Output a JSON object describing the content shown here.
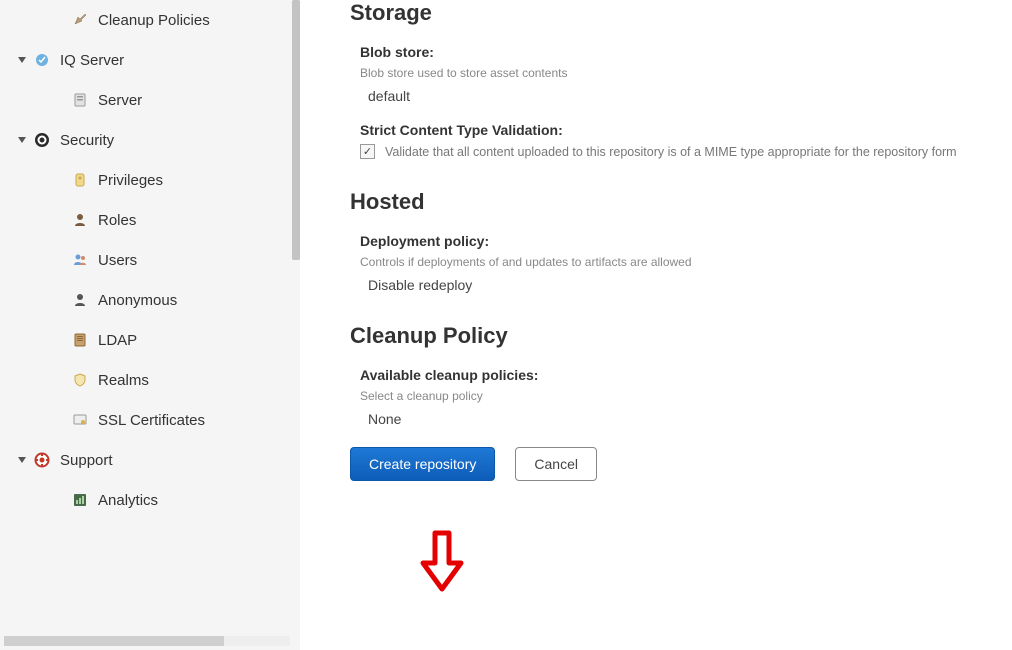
{
  "sidebar": {
    "cleanup_policies": "Cleanup Policies",
    "iq_server": "IQ Server",
    "server": "Server",
    "security": "Security",
    "privileges": "Privileges",
    "roles": "Roles",
    "users": "Users",
    "anonymous": "Anonymous",
    "ldap": "LDAP",
    "realms": "Realms",
    "ssl_certs": "SSL Certificates",
    "support": "Support",
    "analytics": "Analytics"
  },
  "storage": {
    "title": "Storage",
    "blob_label": "Blob store:",
    "blob_help": "Blob store used to store asset contents",
    "blob_value": "default",
    "strict_label": "Strict Content Type Validation:",
    "strict_checkbox_text": "Validate that all content uploaded to this repository is of a MIME type appropriate for the repository form"
  },
  "hosted": {
    "title": "Hosted",
    "deploy_label": "Deployment policy:",
    "deploy_help": "Controls if deployments of and updates to artifacts are allowed",
    "deploy_value": "Disable redeploy"
  },
  "cleanup": {
    "title": "Cleanup Policy",
    "avail_label": "Available cleanup policies:",
    "avail_help": "Select a cleanup policy",
    "avail_value": "None"
  },
  "buttons": {
    "create": "Create repository",
    "cancel": "Cancel"
  }
}
